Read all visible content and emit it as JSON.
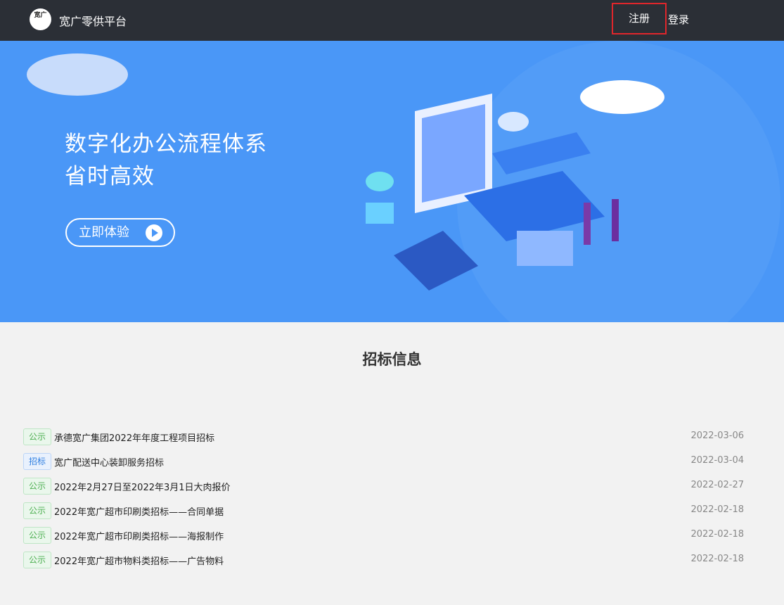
{
  "header": {
    "logo_text": "宽广",
    "brand": "宽广零供平台",
    "register_label": "注册",
    "login_label": "登录"
  },
  "hero": {
    "line1": "数字化办公流程体系",
    "line2": "省时高效",
    "cta_label": "立即体验"
  },
  "section": {
    "title": "招标信息"
  },
  "notices": [
    {
      "tag": "公示",
      "type": "gs",
      "title": "承德宽广集团2022年年度工程项目招标",
      "date": "2022-03-06"
    },
    {
      "tag": "招标",
      "type": "zb",
      "title": "宽广配送中心装卸服务招标",
      "date": "2022-03-04"
    },
    {
      "tag": "公示",
      "type": "gs",
      "title": "2022年2月27日至2022年3月1日大肉报价",
      "date": "2022-02-27"
    },
    {
      "tag": "公示",
      "type": "gs",
      "title": "2022年宽广超市印刷类招标——合同单据",
      "date": "2022-02-18"
    },
    {
      "tag": "公示",
      "type": "gs",
      "title": "2022年宽广超市印刷类招标——海报制作",
      "date": "2022-02-18"
    },
    {
      "tag": "公示",
      "type": "gs",
      "title": "2022年宽广超市物料类招标——广告物料",
      "date": "2022-02-18"
    }
  ]
}
